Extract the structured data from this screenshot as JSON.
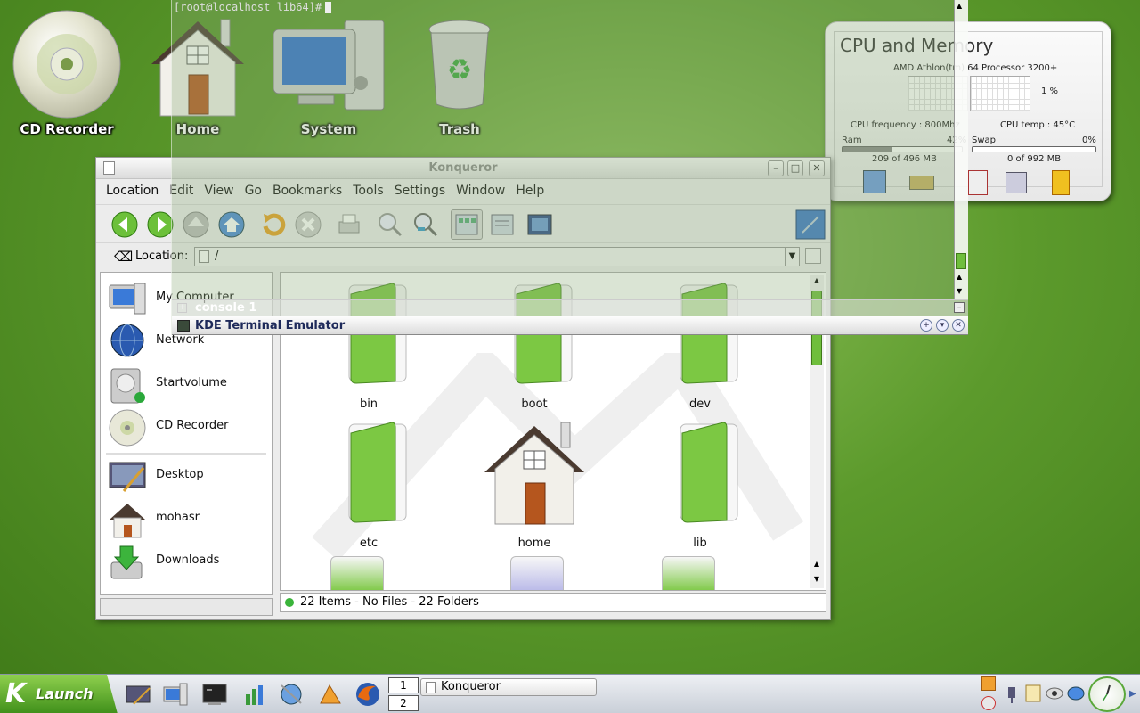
{
  "desktop": {
    "icons": [
      {
        "label": "CD Recorder"
      },
      {
        "label": "Home"
      },
      {
        "label": "System"
      },
      {
        "label": "Trash"
      }
    ]
  },
  "cpu_widget": {
    "title": "CPU and Memory",
    "processor": "AMD Athlon(tm) 64 Processor 3200+",
    "cpu_load": "1 %",
    "cpu_frequency": "CPU frequency : 800Mhz",
    "cpu_temp": "CPU temp : 45°C",
    "ram_label": "Ram",
    "ram_percent": "42%",
    "ram_fraction": 0.42,
    "ram_detail": "209 of 496 MB",
    "swap_label": "Swap",
    "swap_percent": "0%",
    "swap_fraction": 0.0,
    "swap_detail": "0 of 992 MB"
  },
  "konqueror": {
    "title": "Konqueror",
    "menu": [
      "Location",
      "Edit",
      "View",
      "Go",
      "Bookmarks",
      "Tools",
      "Settings",
      "Window",
      "Help"
    ],
    "location_label": "Location:",
    "location_value": "/",
    "sidebar": [
      {
        "label": "My Computer",
        "icon": "computer-icon"
      },
      {
        "label": "Network",
        "icon": "network-globe-icon"
      },
      {
        "label": "Startvolume",
        "icon": "hard-disk-icon"
      },
      {
        "label": "CD Recorder",
        "icon": "cd-icon"
      },
      {
        "label": "Desktop",
        "icon": "desktop-icon"
      },
      {
        "label": "mohasr",
        "icon": "home-icon"
      },
      {
        "label": "Downloads",
        "icon": "downloads-icon"
      }
    ],
    "files": [
      {
        "name": "bin",
        "icon": "folder-icon"
      },
      {
        "name": "boot",
        "icon": "folder-icon"
      },
      {
        "name": "dev",
        "icon": "folder-icon"
      },
      {
        "name": "etc",
        "icon": "folder-icon"
      },
      {
        "name": "home",
        "icon": "home-folder-icon"
      },
      {
        "name": "lib",
        "icon": "folder-icon"
      }
    ],
    "status": "22 Items - No Files - 22 Folders"
  },
  "terminal": {
    "prompt": "[root@localhost lib64]#",
    "tab_label": "console 1",
    "title": "KDE Terminal Emulator"
  },
  "taskbar": {
    "launch_label": "Launch",
    "launch_k": "K",
    "pager": [
      "1",
      "2"
    ],
    "task_label": "Konqueror"
  },
  "colors": {
    "folder_green": "#7cc843",
    "desktop_green": "#5c9a2c",
    "terminal_title": "#1e2a5a"
  }
}
